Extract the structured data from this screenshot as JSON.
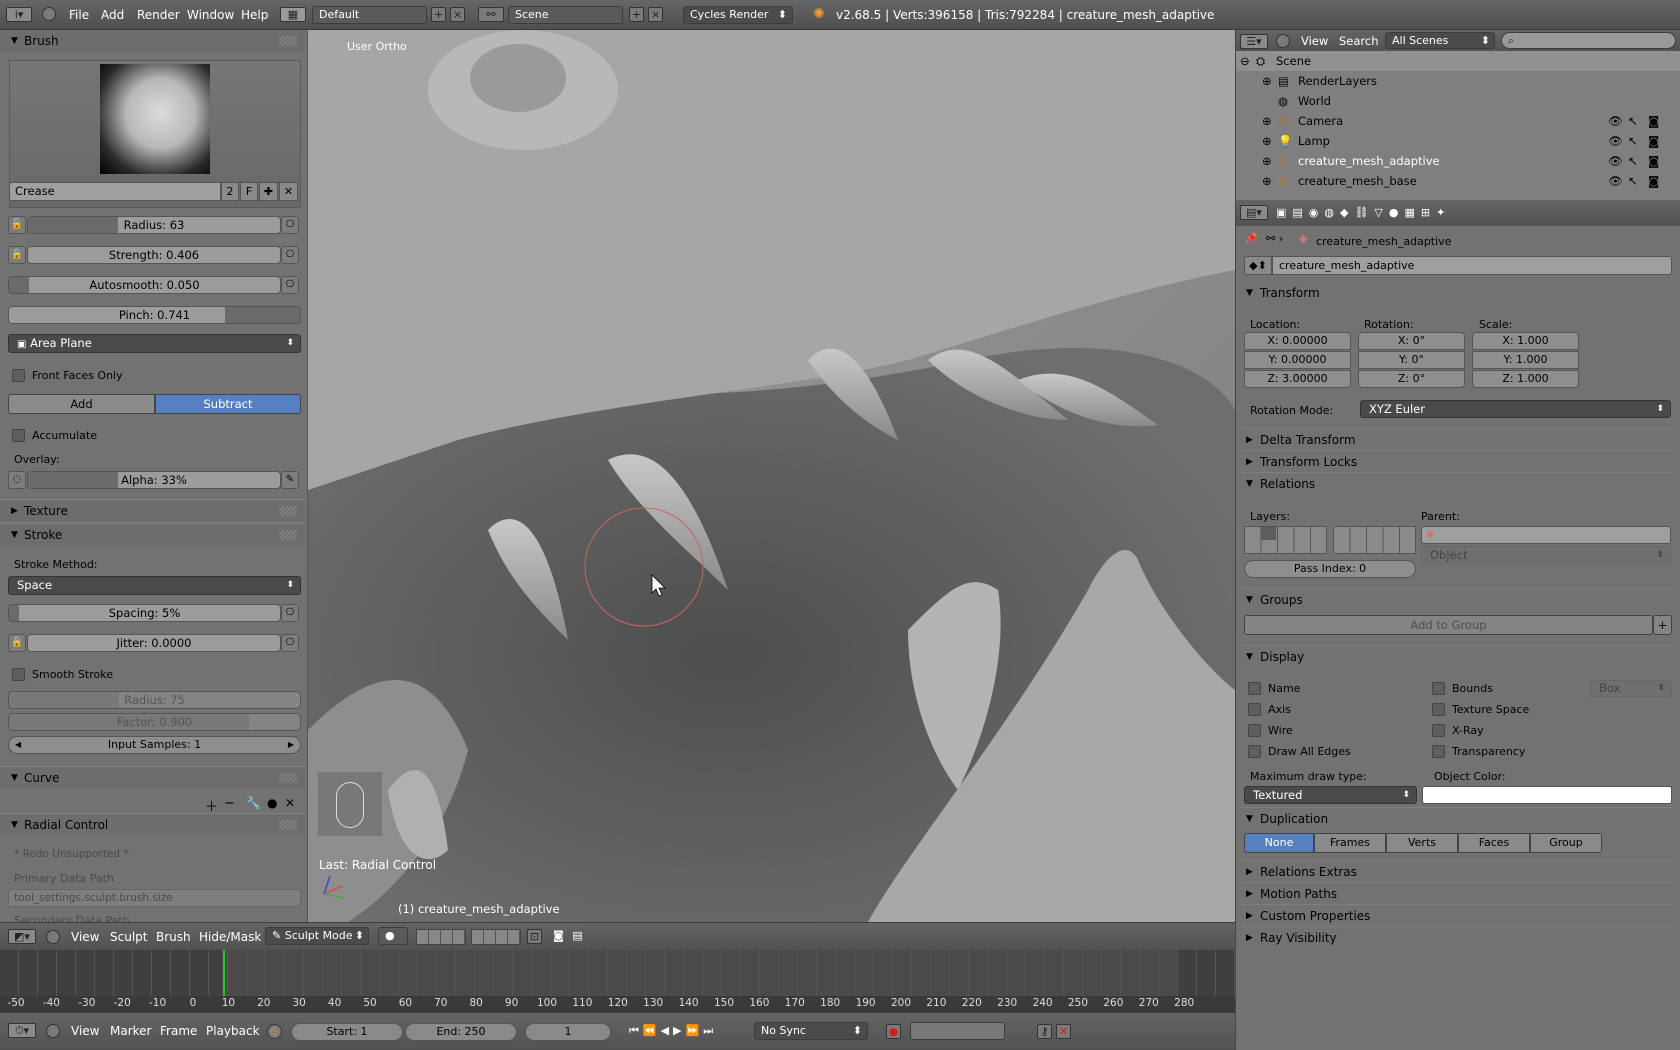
{
  "topbar": {
    "menus": [
      "File",
      "Add",
      "Render",
      "Window",
      "Help"
    ],
    "layout": "Default",
    "scene": "Scene",
    "engine": "Cycles Render",
    "info": "v2.68.5 | Verts:396158 | Tris:792284 | creature_mesh_adaptive"
  },
  "brush": {
    "panel_title": "Brush",
    "name": "Crease",
    "users": "2",
    "fake_user": "F",
    "radius": "Radius: 63",
    "strength": "Strength: 0.406",
    "autosmooth": "Autosmooth: 0.050",
    "pinch": "Pinch: 0.741",
    "pinch_fraction": 0.741,
    "plane": "Area Plane",
    "front_faces": "Front Faces Only",
    "add": "Add",
    "subtract": "Subtract",
    "accumulate": "Accumulate",
    "overlay": "Overlay:",
    "alpha": "Alpha: 33%"
  },
  "texture": {
    "title": "Texture"
  },
  "stroke": {
    "title": "Stroke",
    "method_label": "Stroke Method:",
    "method": "Space",
    "spacing": "Spacing: 5%",
    "jitter": "Jitter: 0.0000",
    "smooth": "Smooth Stroke",
    "radius": "Radius: 75",
    "factor": "Factor: 0.900",
    "input_samples": "Input Samples: 1"
  },
  "curve": {
    "title": "Curve"
  },
  "radial": {
    "title": "Radial Control",
    "redo": "* Redo Unsupported *",
    "primary_label": "Primary Data Path",
    "primary_value": "tool_settings.sculpt.brush.size",
    "secondary_label": "Secondary Data Path"
  },
  "viewport": {
    "view_name": "User Ortho",
    "last_op": "Last: Radial Control",
    "object_label": "(1) creature_mesh_adaptive"
  },
  "view_header": {
    "menus": [
      "View",
      "Sculpt",
      "Brush",
      "Hide/Mask"
    ],
    "mode": "Sculpt Mode"
  },
  "timeline": {
    "ticks": [
      "-50",
      "-40",
      "-30",
      "-20",
      "-10",
      "0",
      "10",
      "20",
      "30",
      "40",
      "50",
      "60",
      "70",
      "80",
      "90",
      "100",
      "110",
      "120",
      "130",
      "140",
      "150",
      "160",
      "170",
      "180",
      "190",
      "200",
      "210",
      "220",
      "230",
      "240",
      "250",
      "260",
      "270",
      "280"
    ],
    "menus": [
      "View",
      "Marker",
      "Frame",
      "Playback"
    ],
    "start": "Start: 1",
    "end": "End: 250",
    "current": "1",
    "sync": "No Sync"
  },
  "outliner": {
    "menus": [
      "View",
      "Search"
    ],
    "scenes": "All Scenes",
    "items": [
      {
        "label": "Scene"
      },
      {
        "label": "RenderLayers"
      },
      {
        "label": "World"
      },
      {
        "label": "Camera"
      },
      {
        "label": "Lamp"
      },
      {
        "label": "creature_mesh_adaptive"
      },
      {
        "label": "creature_mesh_base"
      }
    ]
  },
  "props": {
    "breadcrumb": "creature_mesh_adaptive",
    "object_name": "creature_mesh_adaptive",
    "transform": "Transform",
    "location": "Location:",
    "rotation": "Rotation:",
    "scale": "Scale:",
    "loc": [
      "X: 0.00000",
      "Y: 0.00000",
      "Z: 3.00000"
    ],
    "rot": [
      "X: 0°",
      "Y: 0°",
      "Z: 0°"
    ],
    "scl": [
      "X: 1.000",
      "Y: 1.000",
      "Z: 1.000"
    ],
    "rotation_mode_label": "Rotation Mode:",
    "rotation_mode": "XYZ Euler",
    "delta_transform": "Delta Transform",
    "transform_locks": "Transform Locks",
    "relations": "Relations",
    "layers": "Layers:",
    "parent": "Parent:",
    "parent_type": "Object",
    "pass_index": "Pass Index: 0",
    "groups": "Groups",
    "add_to_group": "Add to Group",
    "display": "Display",
    "display_left": [
      "Name",
      "Axis",
      "Wire",
      "Draw All Edges"
    ],
    "display_right": [
      "Bounds",
      "Texture Space",
      "X-Ray",
      "Transparency"
    ],
    "bounds_type": "Box",
    "max_draw_label": "Maximum draw type:",
    "max_draw": "Textured",
    "object_color_label": "Object Color:",
    "duplication": "Duplication",
    "dup_options": [
      "None",
      "Frames",
      "Verts",
      "Faces",
      "Group"
    ],
    "relations_extras": "Relations Extras",
    "motion_paths": "Motion Paths",
    "custom_properties": "Custom Properties",
    "ray_visibility": "Ray Visibility"
  }
}
